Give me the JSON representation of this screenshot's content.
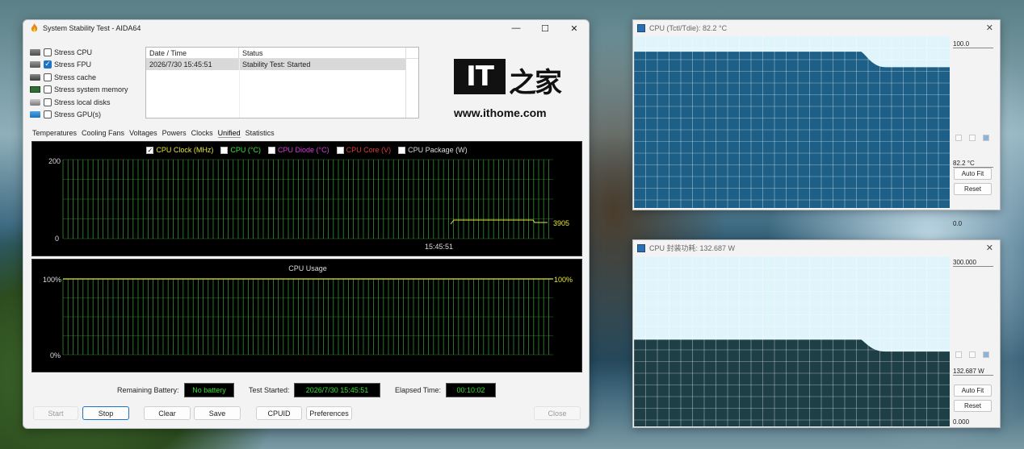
{
  "main_window": {
    "title": "System Stability Test - AIDA64",
    "controls": {
      "minimize": "—",
      "maximize": "☐",
      "close": "✕"
    },
    "stress_options": [
      {
        "label": "Stress CPU",
        "checked": false
      },
      {
        "label": "Stress FPU",
        "checked": true
      },
      {
        "label": "Stress cache",
        "checked": false
      },
      {
        "label": "Stress system memory",
        "checked": false
      },
      {
        "label": "Stress local disks",
        "checked": false
      },
      {
        "label": "Stress GPU(s)",
        "checked": false
      }
    ],
    "log": {
      "headers": {
        "datetime": "Date / Time",
        "status": "Status"
      },
      "rows": [
        {
          "datetime": "2026/7/30 15:45:51",
          "status": "Stability Test: Started"
        }
      ]
    },
    "logo": {
      "text_left": "IT",
      "text_right": "之家",
      "url": "www.ithome.com"
    },
    "tabs": [
      "Temperatures",
      "Cooling Fans",
      "Voltages",
      "Powers",
      "Clocks",
      "Unified",
      "Statistics"
    ],
    "active_tab": "Unified",
    "unified_graph": {
      "legend": [
        {
          "label": "CPU Clock (MHz)",
          "checked": true,
          "color": "#e6e63a"
        },
        {
          "label": "CPU (°C)",
          "checked": false,
          "color": "#3be33b"
        },
        {
          "label": "CPU Diode (°C)",
          "checked": false,
          "color": "#d93bd9"
        },
        {
          "label": "CPU Core (V)",
          "checked": false,
          "color": "#e23a3a"
        },
        {
          "label": "CPU Package (W)",
          "checked": false,
          "color": "#dddddd"
        }
      ],
      "y_max": "200",
      "y_min": "0",
      "time_label": "15:45:51",
      "current_value": "3905"
    },
    "usage_graph": {
      "title": "CPU Usage",
      "y_max": "100%",
      "y_min": "0%",
      "current_value": "100%"
    },
    "status": {
      "battery_label": "Remaining Battery:",
      "battery_value": "No battery",
      "started_label": "Test Started:",
      "started_value": "2026/7/30 15:45:51",
      "elapsed_label": "Elapsed Time:",
      "elapsed_value": "00:10:02"
    },
    "buttons": {
      "start": "Start",
      "stop": "Stop",
      "clear": "Clear",
      "save": "Save",
      "cpuid": "CPUID",
      "preferences": "Preferences",
      "close": "Close"
    }
  },
  "sensor_window_1": {
    "title": "CPU (Tctl/Tdie): 82.2 °C",
    "max_value": "100.0",
    "current_value": "82.2 °C",
    "min_value": "0.0",
    "auto_fit": "Auto Fit",
    "reset": "Reset",
    "level_before": 0.91,
    "level_after": 0.82
  },
  "sensor_window_2": {
    "title": "CPU 封装功耗: 132.687 W",
    "max_value": "300.000",
    "current_value": "132.687 W",
    "min_value": "0.000",
    "auto_fit": "Auto Fit",
    "reset": "Reset",
    "level_before": 0.51,
    "level_after": 0.44
  },
  "colors": {
    "grid_green": "#3fa83f",
    "lcd_text": "#2fe22f",
    "graph_fill": "#1d5f86",
    "graph_fill2": "#1f3f47",
    "graph_bg": "#dff4fb",
    "accent": "#1f73c4"
  }
}
